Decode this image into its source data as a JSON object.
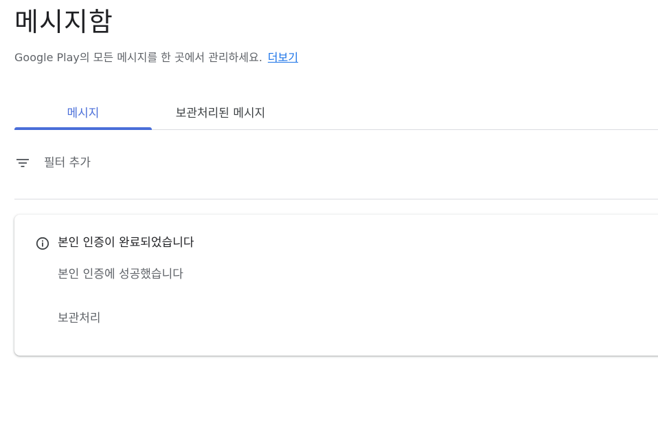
{
  "header": {
    "title": "메시지함",
    "subtitle": "Google Play의 모든 메시지를 한 곳에서 관리하세요.",
    "more_link": "더보기"
  },
  "tabs": [
    {
      "label": "메시지",
      "active": true
    },
    {
      "label": "보관처리된 메시지",
      "active": false
    }
  ],
  "filter": {
    "icon": "filter-list-icon",
    "label": "필터 추가"
  },
  "messages": [
    {
      "icon": "info-icon",
      "title": "본인 인증이 완료되었습니다",
      "body": "본인 인증에 성공했습니다",
      "action": "보관처리"
    }
  ],
  "colors": {
    "accent": "#4a6ed9",
    "link": "#1a73e8",
    "divider": "#dadce0",
    "text_primary": "#202124",
    "text_secondary": "#5f6368"
  }
}
